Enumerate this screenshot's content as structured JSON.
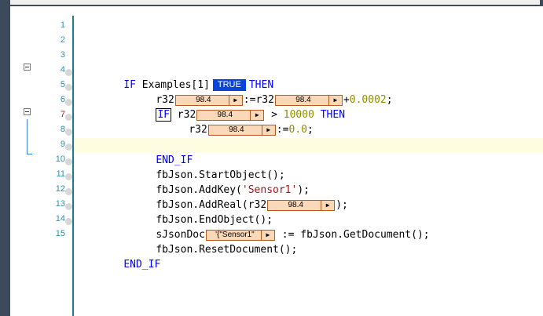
{
  "colors": {
    "keyword": "#0000ff",
    "number": "#8c8c00",
    "string": "#a31515",
    "line_number": "#2b91af",
    "monitor_bg": "#fbd9b8",
    "monitor_border": "#b85a1c",
    "bool_bg": "#0a44d8",
    "current_line": "#fffde1"
  },
  "icons": {
    "collapse": "minus-box-icon",
    "breakpoint": "breakpoint-circle-icon",
    "monitor_arrow": "triangle-right-icon"
  },
  "editor": {
    "line_numbers": [
      "1",
      "2",
      "3",
      "4",
      "5",
      "6",
      "7",
      "8",
      "9",
      "10",
      "11",
      "12",
      "13",
      "14",
      "15"
    ],
    "monitor_arrow": "▶",
    "l3": {
      "kw_if": "IF",
      "expr": "Examples[1]",
      "bool": "TRUE",
      "kw_then": "THEN"
    },
    "l4": {
      "lhs": "r32",
      "lhs_val": "98.4",
      "assign": ":=",
      "rhs": "r32",
      "rhs_val": "98.4",
      "plus": "+",
      "num": "0.0002",
      "semi": ";"
    },
    "l5": {
      "kw_if": "IF",
      "var": "r32",
      "val": "98.4",
      "op": " > ",
      "num": "10000",
      "kw_then": "THEN"
    },
    "l6": {
      "var": "r32",
      "val": "98.4",
      "assign": ":=",
      "num": "0.0",
      "semi": ";"
    },
    "l7": {
      "kw": "END_IF"
    },
    "l8": {
      "text": "fbJson.StartObject();"
    },
    "l9": {
      "pre": "fbJson.AddKey(",
      "str": "'Sensor1'",
      "post": ");"
    },
    "l10": {
      "pre": "fbJson.AddReal(r32",
      "val": "98.4",
      "post": ");"
    },
    "l11": {
      "text": "fbJson.EndObject();"
    },
    "l12": {
      "pre": "sJsonDoc",
      "val": "'{\"Sensor1\"",
      "post": " := fbJson.GetDocument();"
    },
    "l13": {
      "text": "fbJson.ResetDocument();"
    },
    "l14": {
      "kw": "END_IF"
    }
  }
}
